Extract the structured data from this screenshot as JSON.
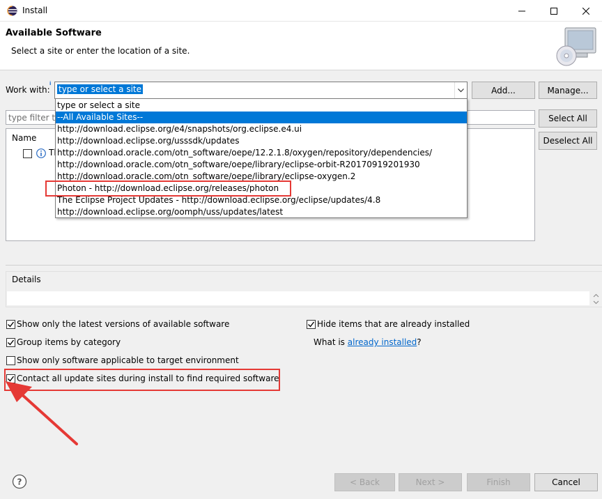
{
  "window": {
    "title": "Install"
  },
  "banner": {
    "title": "Available Software",
    "subtitle": "Select a site or enter the location of a site."
  },
  "work_with": {
    "label": "Work with:",
    "value": "type or select a site",
    "add_label": "Add...",
    "manage_label": "Manage..."
  },
  "dropdown": {
    "options": [
      "type or select a site",
      "--All Available Sites--",
      "http://download.eclipse.org/e4/snapshots/org.eclipse.e4.ui",
      "http://download.eclipse.org/usssdk/updates",
      "http://download.oracle.com/otn_software/oepe/12.2.1.8/oxygen/repository/dependencies/",
      "http://download.oracle.com/otn_software/oepe/library/eclipse-orbit-R20170919201930",
      "http://download.oracle.com/otn_software/oepe/library/eclipse-oxygen.2",
      "Photon - http://download.eclipse.org/releases/photon",
      "The Eclipse Project Updates - http://download.eclipse.org/eclipse/updates/4.8",
      "http://download.eclipse.org/oomph/uss/updates/latest"
    ],
    "selected_index": 1
  },
  "filter": {
    "placeholder": "type filter te"
  },
  "side_buttons": {
    "select_all": "Select All",
    "deselect_all": "Deselect All"
  },
  "tree": {
    "header": "Name",
    "item_label": "Tl"
  },
  "details": {
    "label": "Details"
  },
  "options": {
    "show_latest": {
      "label": "Show only the latest versions of available software",
      "checked": true
    },
    "hide_installed": {
      "label": "Hide items that are already installed",
      "checked": true
    },
    "group_by_category": {
      "label": "Group items by category",
      "checked": true
    },
    "what_is_prefix": "What is ",
    "what_is_link": "already installed",
    "what_is_suffix": "?",
    "target_env": {
      "label": "Show only software applicable to target environment",
      "checked": false
    },
    "contact_sites": {
      "label": "Contact all update sites during install to find required software",
      "checked": true
    }
  },
  "footer": {
    "back": "< Back",
    "next": "Next >",
    "finish": "Finish",
    "cancel": "Cancel"
  },
  "colors": {
    "highlight_red": "#e53935",
    "selection_blue": "#0078d7",
    "link_blue": "#0066cc"
  }
}
